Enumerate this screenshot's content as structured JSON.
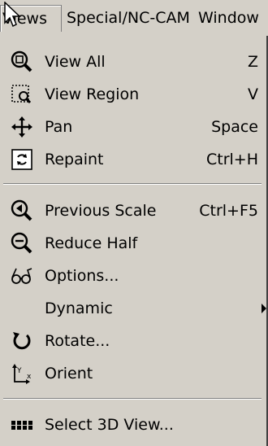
{
  "menubar": {
    "items": [
      {
        "label": "Views"
      },
      {
        "label": "Special/NC-CAM"
      },
      {
        "label": "Window"
      }
    ]
  },
  "menu": {
    "items": [
      {
        "label": "View All",
        "shortcut": "Z",
        "icon": "zoom-all-icon"
      },
      {
        "label": "View Region",
        "shortcut": "V",
        "icon": "view-region-icon"
      },
      {
        "label": "Pan",
        "shortcut": "Space",
        "icon": "pan-icon"
      },
      {
        "label": "Repaint",
        "shortcut": "Ctrl+H",
        "icon": "repaint-icon"
      },
      {
        "label": "Previous Scale",
        "shortcut": "Ctrl+F5",
        "icon": "previous-scale-icon"
      },
      {
        "label": "Reduce Half",
        "shortcut": "",
        "icon": "zoom-out-icon"
      },
      {
        "label": "Options...",
        "shortcut": "",
        "icon": "glasses-icon"
      },
      {
        "label": "Dynamic",
        "shortcut": "",
        "icon": "submenu-arrow-icon"
      },
      {
        "label": "Rotate...",
        "shortcut": "",
        "icon": "rotate-icon"
      },
      {
        "label": "Orient",
        "shortcut": "",
        "icon": "orient-axes-icon"
      },
      {
        "label": "Select 3D View...",
        "shortcut": "",
        "icon": "grid-view-icon"
      }
    ]
  }
}
